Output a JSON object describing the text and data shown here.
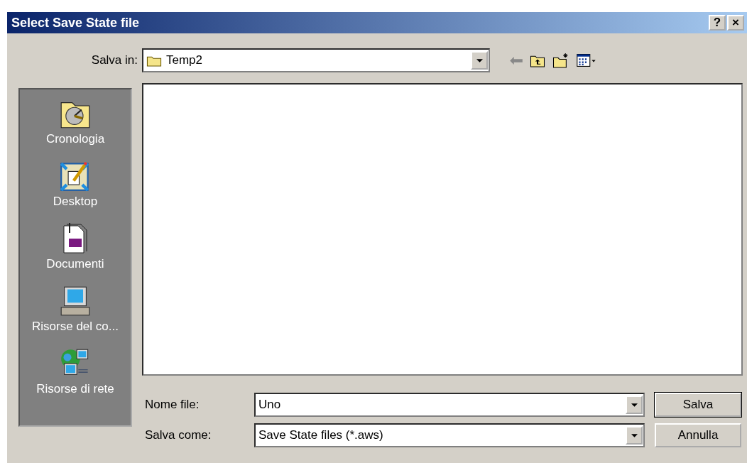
{
  "window": {
    "title": "Select Save State file",
    "title_buttons": [
      "?",
      "×"
    ]
  },
  "location": {
    "label": "Salva in:",
    "value": "Temp2"
  },
  "places": [
    {
      "label": "Cronologia",
      "kind": "history"
    },
    {
      "label": "Desktop",
      "kind": "desktop"
    },
    {
      "label": "Documenti",
      "kind": "documents"
    },
    {
      "label": "Risorse del co...",
      "kind": "computer"
    },
    {
      "label": "Risorse di rete",
      "kind": "network"
    }
  ],
  "file_name": {
    "label": "Nome file:",
    "value": "Uno"
  },
  "file_type": {
    "label": "Salva come:",
    "value": "Save State files (*.aws)"
  },
  "buttons": [
    {
      "label": "Salva",
      "default": true
    },
    {
      "label": "Annulla",
      "default": false
    }
  ]
}
